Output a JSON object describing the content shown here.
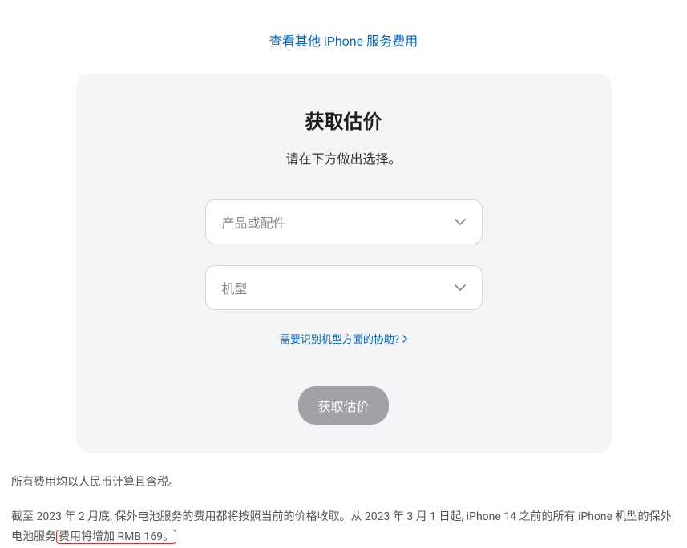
{
  "topLink": {
    "text": "查看其他 iPhone 服务费用"
  },
  "card": {
    "title": "获取估价",
    "subtitle": "请在下方做出选择。",
    "select1": {
      "placeholder": "产品或配件"
    },
    "select2": {
      "placeholder": "机型"
    },
    "helpLink": "需要识别机型方面的协助?",
    "submitButton": "获取估价"
  },
  "footer": {
    "line1": "所有费用均以人民币计算且含税。",
    "line2_part1": "截至 2023 年 2 月底, 保外电池服务的费用都将按照当前的价格收取。从 2023 年 3 月 1 日起, iPhone 14 之前的所有 iPhone 机型的保外电池服务",
    "line2_highlight": "费用将增加 RMB 169。"
  }
}
